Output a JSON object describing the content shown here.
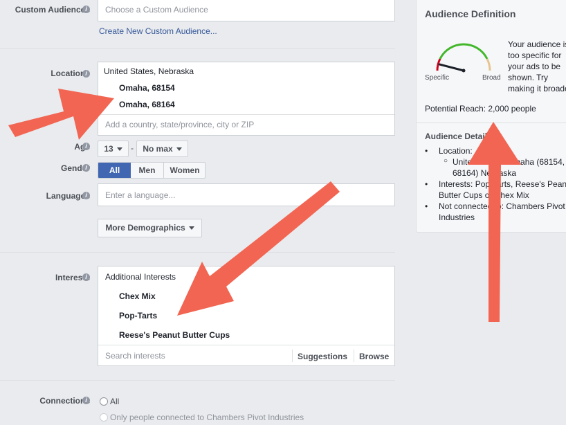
{
  "form": {
    "custom_audiences": {
      "label": "Custom Audiences",
      "placeholder": "Choose a Custom Audience",
      "create_link": "Create New Custom Audience..."
    },
    "locations": {
      "label": "Locations",
      "group": "United States, Nebraska",
      "items": [
        "Omaha, 68154",
        "Omaha, 68164"
      ],
      "placeholder": "Add a country, state/province, city or ZIP"
    },
    "age": {
      "label": "Age",
      "min": "13",
      "dash": "-",
      "max": "No max"
    },
    "gender": {
      "label": "Gender",
      "options": [
        "All",
        "Men",
        "Women"
      ],
      "selected": "All"
    },
    "languages": {
      "label": "Languages",
      "placeholder": "Enter a language..."
    },
    "more_demographics": "More Demographics",
    "interests": {
      "label": "Interests",
      "group": "Additional Interests",
      "items": [
        "Chex Mix",
        "Pop-Tarts",
        "Reese's Peanut Butter Cups"
      ],
      "placeholder": "Search interests",
      "suggestions": "Suggestions",
      "browse": "Browse"
    },
    "connections": {
      "label": "Connections",
      "options": [
        "All",
        "Only people connected to Chambers Pivot Industries"
      ]
    }
  },
  "panel": {
    "title": "Audience Definition",
    "gauge": {
      "min_label": "Specific",
      "max_label": "Broad",
      "level": 0.08
    },
    "message_lines": [
      "Your audience is",
      "too specific for",
      "your ads to be",
      "shown. Try",
      "making it broader."
    ],
    "reach": "Potential Reach: 2,000 people",
    "details_title": "Audience Details:",
    "details": {
      "location_label": "Location:",
      "location_lines": [
        "United States: Omaha (68154,",
        "68164) Nebraska"
      ],
      "interests_lines": [
        "Interests: Pop-Tarts, Reese's Peanut",
        "Butter Cups or Chex Mix"
      ],
      "connections_lines": [
        "Not connected to: Chambers Pivot",
        "Industries"
      ]
    }
  },
  "colors": {
    "arrow": "#f26552",
    "link": "#365899",
    "selected": "#4267b2"
  }
}
